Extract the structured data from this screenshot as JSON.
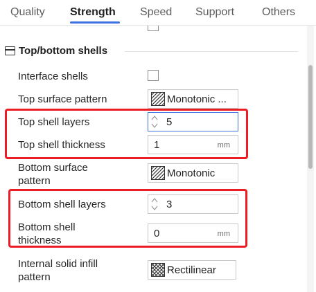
{
  "tabs": [
    {
      "label": "Quality",
      "active": false
    },
    {
      "label": "Strength",
      "active": true
    },
    {
      "label": "Speed",
      "active": false
    },
    {
      "label": "Support",
      "active": false
    },
    {
      "label": "Others",
      "active": false
    }
  ],
  "colors": {
    "accent": "#3d6fe0",
    "highlight": "#ec1c24"
  },
  "section": {
    "title": "Top/bottom shells",
    "icon": "section-panel-icon"
  },
  "settings": {
    "interface_shells": {
      "label": "Interface shells",
      "checked": false
    },
    "top_surface_pattern": {
      "label": "Top surface pattern",
      "value": "Monotonic ...",
      "icon": "monotonic-pattern-icon"
    },
    "top_shell_layers": {
      "label": "Top shell layers",
      "value": "5"
    },
    "top_shell_thickness": {
      "label": "Top shell thickness",
      "value": "1",
      "unit": "mm"
    },
    "bottom_surface_pattern": {
      "label_line1": "Bottom surface",
      "label_line2": "pattern",
      "value": "Monotonic",
      "icon": "monotonic-pattern-icon"
    },
    "bottom_shell_layers": {
      "label": "Bottom shell layers",
      "value": "3"
    },
    "bottom_shell_thickness": {
      "label_line1": "Bottom shell",
      "label_line2": "thickness",
      "value": "0",
      "unit": "mm"
    },
    "internal_solid_infill_pattern": {
      "label_line1": "Internal solid infill",
      "label_line2": "pattern",
      "value": "Rectilinear",
      "icon": "rectilinear-pattern-icon"
    }
  }
}
